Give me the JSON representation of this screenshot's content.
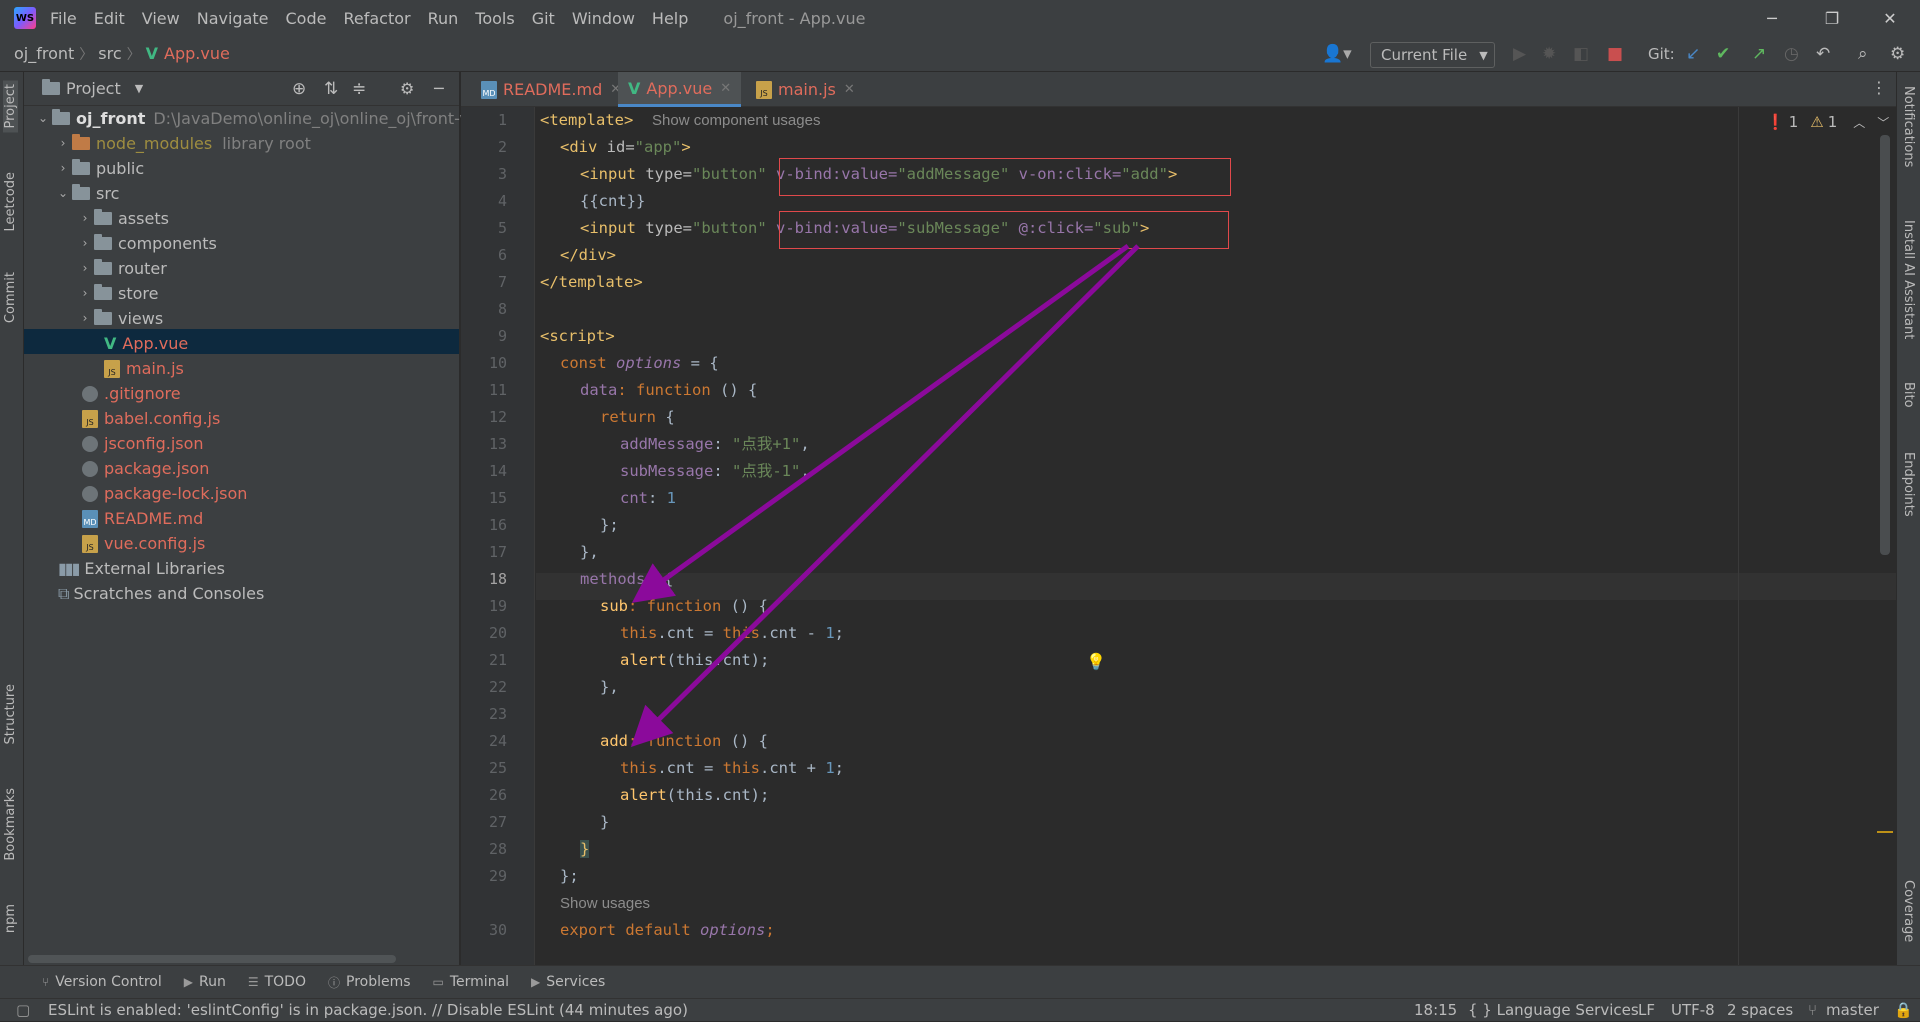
{
  "app": {
    "window_title": "oj_front - App.vue",
    "menu": [
      "File",
      "Edit",
      "View",
      "Navigate",
      "Code",
      "Refactor",
      "Run",
      "Tools",
      "Git",
      "Window",
      "Help"
    ]
  },
  "breadcrumb": {
    "project": "oj_front",
    "folder": "src",
    "file": "App.vue"
  },
  "toolbar": {
    "run_config": "Current File",
    "git_label": "Git:"
  },
  "left_tool_tabs": [
    "Project",
    "Leetcode",
    "Commit",
    "Structure",
    "Bookmarks",
    "npm"
  ],
  "right_tool_tabs": [
    "Notifications",
    "Install AI Assistant",
    "Bito",
    "Endpoints",
    "Coverage"
  ],
  "project_panel": {
    "title": "Project",
    "root_name": "oj_front",
    "root_path": "D:\\JavaDemo\\online_oj\\online_oj\\front-vue",
    "node_modules": "node_modules",
    "node_modules_hint": "library root",
    "public": "public",
    "src": "src",
    "assets": "assets",
    "components": "components",
    "router": "router",
    "store": "store",
    "views": "views",
    "app_vue": "App.vue",
    "main_js": "main.js",
    "gitignore": ".gitignore",
    "babel": "babel.config.js",
    "jsconfig": "jsconfig.json",
    "package": "package.json",
    "package_lock": "package-lock.json",
    "readme": "README.md",
    "vue_config": "vue.config.js",
    "external": "External Libraries",
    "scratches": "Scratches and Consoles"
  },
  "editor_tabs": [
    {
      "label": "README.md"
    },
    {
      "label": "App.vue"
    },
    {
      "label": "main.js"
    }
  ],
  "inspections": {
    "errors": "1",
    "warnings": "1"
  },
  "line_numbers": [
    "1",
    "2",
    "3",
    "4",
    "5",
    "6",
    "7",
    "8",
    "9",
    "10",
    "11",
    "12",
    "13",
    "14",
    "15",
    "16",
    "17",
    "18",
    "19",
    "20",
    "21",
    "22",
    "23",
    "24",
    "25",
    "26",
    "27",
    "28",
    "29",
    "30"
  ],
  "code": {
    "l1_tag": "<template>",
    "l1_hint": "Show component usages",
    "l2_a": "<div ",
    "l2_b": "id=",
    "l2_c": "\"app\"",
    "l2_d": ">",
    "l3_a": "<input ",
    "l3_b": "type=",
    "l3_c": "\"button\"",
    "l3_d": " v-bind:value=",
    "l3_e": "\"addMessage\"",
    "l3_f": " v-on:click=",
    "l3_g": "\"add\"",
    "l3_h": ">",
    "l4": "{{cnt}}",
    "l5_d": " v-bind:value=",
    "l5_e": "\"subMessage\"",
    "l5_f": " @:click=",
    "l5_g": "\"sub\"",
    "l6": "</div>",
    "l7": "</template>",
    "l9": "<script>",
    "l10_kw": "const ",
    "l10_var": "options",
    "l10_rest": " = {",
    "l11_prop": "data",
    "l11_kw": ": function ",
    "l11_rest": "() {",
    "l12_kw": "return ",
    "l12_rest": "{",
    "l13_prop": "addMessage",
    "l13_str": "\"点我+1\"",
    "l14_prop": "subMessage",
    "l14_str": "\"点我-1\"",
    "l15_prop": "cnt",
    "l15_num": "1",
    "l16": "};",
    "l17": "},",
    "l18_prop": "methods",
    "l18_rest": ": {",
    "l19_fn": "sub",
    "l19_kw": ": function ",
    "l19_rest": "() {",
    "l20_this": "this",
    "l20_a": ".cnt = ",
    "l20_b": ".cnt - ",
    "l20_num": "1",
    "l21_fn": "alert",
    "l21_rest": "(this.cnt);",
    "l22": "},",
    "l24_fn": "add",
    "l25_b": ".cnt + ",
    "l26_fn": "alert",
    "l27": "}",
    "l28": "}",
    "l29": "};",
    "usages_hint": "Show usages",
    "l30_kw": "export default ",
    "l30_var": "options",
    "l30_end": ";"
  },
  "bottom_tools": [
    "Version Control",
    "Run",
    "TODO",
    "Problems",
    "Terminal",
    "Services"
  ],
  "status": {
    "message": "ESLint is enabled: 'eslintConfig' is in package.json. // Disable ESLint (44 minutes ago)",
    "position": "18:15",
    "lang": "{ } Language Services",
    "line_sep": "LF",
    "encoding": "UTF-8",
    "indent": "2 spaces",
    "branch": "master"
  },
  "colors": {
    "accent": "#4a88c7",
    "annotation_box": "#e0494b",
    "annotation_arrow": "#8b0a9b",
    "vue_green": "#41b883"
  }
}
